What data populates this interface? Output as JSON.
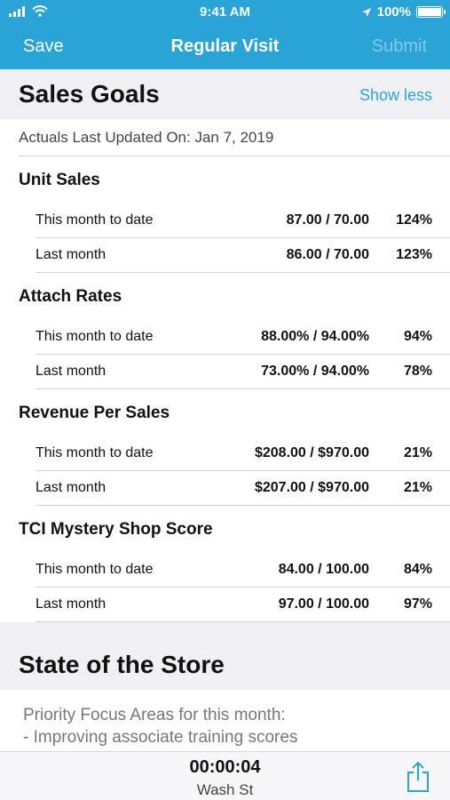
{
  "status_bar": {
    "time": "9:41 AM",
    "battery": "100%"
  },
  "nav": {
    "save_label": "Save",
    "title": "Regular Visit",
    "submit_label": "Submit"
  },
  "sales_goals": {
    "title": "Sales Goals",
    "toggle_label": "Show less",
    "updated": "Actuals Last Updated On: Jan 7, 2019",
    "groups": [
      {
        "title": "Unit Sales",
        "rows": [
          {
            "label": "This month to date",
            "value": "87.00 / 70.00",
            "pct": "124%"
          },
          {
            "label": "Last month",
            "value": "86.00 / 70.00",
            "pct": "123%"
          }
        ]
      },
      {
        "title": "Attach Rates",
        "rows": [
          {
            "label": "This month to date",
            "value": "88.00% / 94.00%",
            "pct": "94%"
          },
          {
            "label": "Last month",
            "value": "73.00% / 94.00%",
            "pct": "78%"
          }
        ]
      },
      {
        "title": "Revenue Per Sales",
        "rows": [
          {
            "label": "This month to date",
            "value": "$208.00 / $970.00",
            "pct": "21%"
          },
          {
            "label": "Last month",
            "value": "$207.00 / $970.00",
            "pct": "21%"
          }
        ]
      },
      {
        "title": "TCI Mystery Shop Score",
        "rows": [
          {
            "label": "This month to date",
            "value": "84.00 / 100.00",
            "pct": "84%"
          },
          {
            "label": "Last month",
            "value": "97.00 / 100.00",
            "pct": "97%"
          }
        ]
      }
    ]
  },
  "state_of_store": {
    "title": "State of the Store",
    "note_line1": "Priority Focus Areas for this month:",
    "note_line2": "- Improving associate training scores"
  },
  "footer": {
    "timer": "00:00:04",
    "store": "Wash St"
  },
  "icons": {
    "signal": "signal-icon",
    "wifi": "wifi-icon",
    "location": "location-arrow-icon",
    "battery": "battery-icon",
    "share": "share-icon"
  },
  "colors": {
    "accent": "#2aa3d6",
    "submit_disabled": "#7fcbe9",
    "section_bg": "#efeff4"
  }
}
